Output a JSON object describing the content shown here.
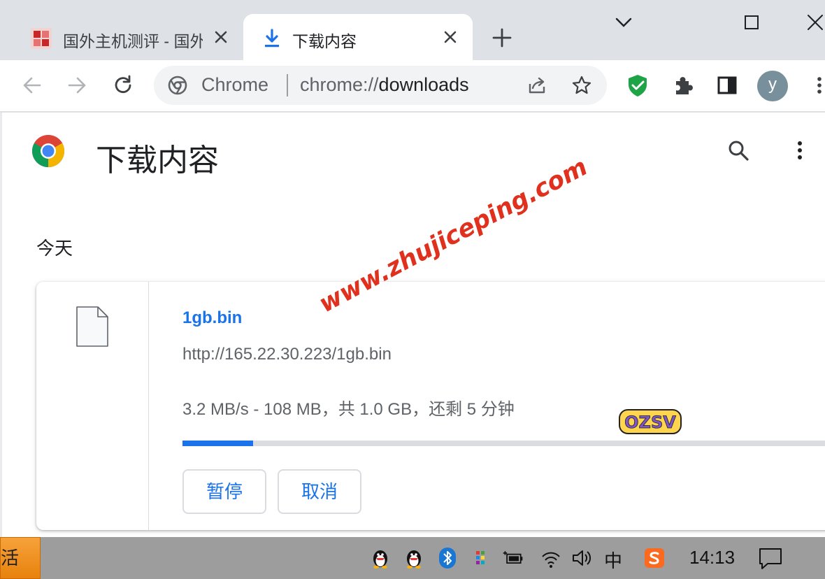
{
  "tabs": [
    {
      "title": "国外主机测评 - 国外",
      "active": false
    },
    {
      "title": "下载内容",
      "active": true
    }
  ],
  "toolbar": {
    "omnibox_chip": "Chrome",
    "url_scheme": "chrome://",
    "url_host": "downloads"
  },
  "profile": {
    "initial": "y",
    "color": "#78909c"
  },
  "page": {
    "title": "下载内容",
    "section": "今天"
  },
  "download": {
    "filename": "1gb.bin",
    "url": "http://165.22.30.223/1gb.bin",
    "status": "3.2 MB/s - 108 MB，共 1.0 GB，还剩 5 分钟",
    "progress_fraction": 0.108,
    "pause_label": "暂停",
    "cancel_label": "取消"
  },
  "watermark": "www.zhujiceping.com",
  "badge_text": "OZSV",
  "taskbar": {
    "start_label": "活",
    "ime_label": "中",
    "clock": "14:13"
  },
  "colors": {
    "accent": "#1a73e8",
    "tab_strip": "#dee1e6",
    "taskbar": "#9d9d9d",
    "shield": "#1ea446"
  }
}
